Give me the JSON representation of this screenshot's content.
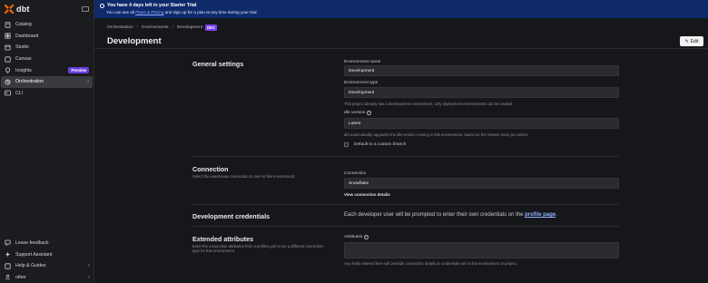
{
  "brand": {
    "name": "dbt",
    "logo_color": "#fe6703"
  },
  "sidebar": {
    "items": [
      {
        "label": "Catalog",
        "icon": "catalog-icon"
      },
      {
        "label": "Dashboard",
        "icon": "dashboard-icon"
      },
      {
        "label": "Studio",
        "icon": "studio-icon"
      },
      {
        "label": "Canvas",
        "icon": "canvas-icon"
      },
      {
        "label": "Insights",
        "icon": "insights-icon",
        "badge": "Preview"
      },
      {
        "label": "Orchestration",
        "icon": "orchestration-icon",
        "active": true
      },
      {
        "label": "CLI",
        "icon": "cli-icon"
      }
    ],
    "bottom_items": [
      {
        "label": "Leave feedback",
        "icon": "feedback-icon"
      },
      {
        "label": "Support Assistant",
        "icon": "support-icon"
      },
      {
        "label": "Help & Guides",
        "icon": "help-icon"
      },
      {
        "label": "other",
        "icon": "user-icon"
      }
    ]
  },
  "banner": {
    "title": "You have 4 days left in your Starter Trial",
    "sub_prefix": "You can see all ",
    "sub_link": "Plans & Pricing",
    "sub_suffix": " and sign up for a plan at any time during your trial."
  },
  "header": {
    "breadcrumbs": [
      "Orchestration",
      "Environments",
      "Development"
    ],
    "badge": "DEV",
    "title": "Development",
    "edit_label": "Edit"
  },
  "general": {
    "title": "General settings",
    "env_name_label": "Environment name",
    "env_name_value": "Development",
    "env_type_label": "Environment type",
    "env_type_value": "Development",
    "env_type_hint": "This project already has a development environment, only deployment environments can be created.",
    "dbt_version_label": "dbt version",
    "dbt_version_value": "Latest",
    "dbt_version_hint": "dbt automatically upgrades the dbt version running in this environment, based on the release track you select.",
    "custom_branch_label": "Default to a custom branch"
  },
  "connection": {
    "title": "Connection",
    "desc": "Select the warehouse connection to use for this environment.",
    "label": "Connection",
    "value": "Snowflake",
    "view_link": "View connection details"
  },
  "credentials": {
    "title": "Development credentials",
    "text_prefix": "Each developer user will be prompted to enter their own credentials on the ",
    "link": "profile page",
    "text_suffix": "."
  },
  "extended": {
    "title": "Extended attributes",
    "desc": "Enter the connection attributes from a profiles.yml to set a different connection type for this environment.",
    "attributes_label": "Attributes",
    "hint": "Any fields entered here will override connection details or credentials set on the environment or project."
  }
}
